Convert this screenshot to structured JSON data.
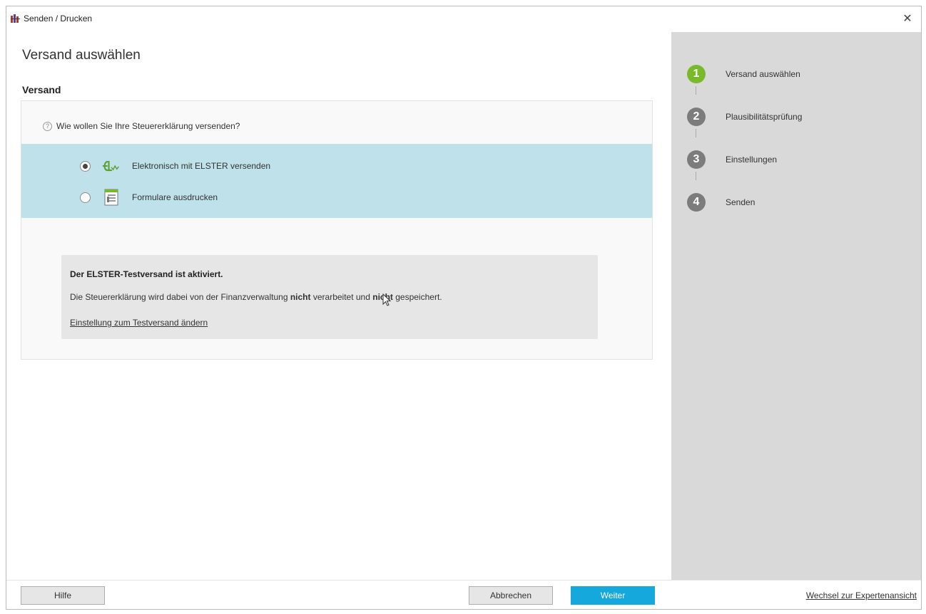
{
  "window": {
    "title": "Senden / Drucken",
    "close_symbol": "✕"
  },
  "main": {
    "page_title": "Versand auswählen",
    "section_title": "Versand",
    "question": "Wie wollen Sie Ihre Steuererklärung versenden?",
    "options": [
      {
        "label": "Elektronisch mit ELSTER versenden",
        "selected": true,
        "icon": "elster-icon"
      },
      {
        "label": "Formulare ausdrucken",
        "selected": false,
        "icon": "form-print-icon"
      }
    ],
    "info": {
      "title": "Der ELSTER-Testversand ist aktiviert.",
      "text_part1": "Die Steuererklärung wird dabei von der Finanzverwaltung ",
      "text_bold1": "nicht",
      "text_part2": " verarbeitet und ",
      "text_bold2": "nicht",
      "text_part3": " gespeichert.",
      "link": "Einstellung zum Testversand ändern"
    }
  },
  "steps": [
    {
      "number": "1",
      "label": "Versand auswählen",
      "active": true
    },
    {
      "number": "2",
      "label": "Plausibilitätsprüfung",
      "active": false
    },
    {
      "number": "3",
      "label": "Einstellungen",
      "active": false
    },
    {
      "number": "4",
      "label": "Senden",
      "active": false
    }
  ],
  "footer": {
    "help_label": "Hilfe",
    "cancel_label": "Abbrechen",
    "next_label": "Weiter",
    "expert_link": "Wechsel zur Expertenansicht"
  },
  "colors": {
    "accent_blue": "#14a8dc",
    "active_step_green": "#7ab929",
    "selection_band": "#bfe1ea"
  }
}
